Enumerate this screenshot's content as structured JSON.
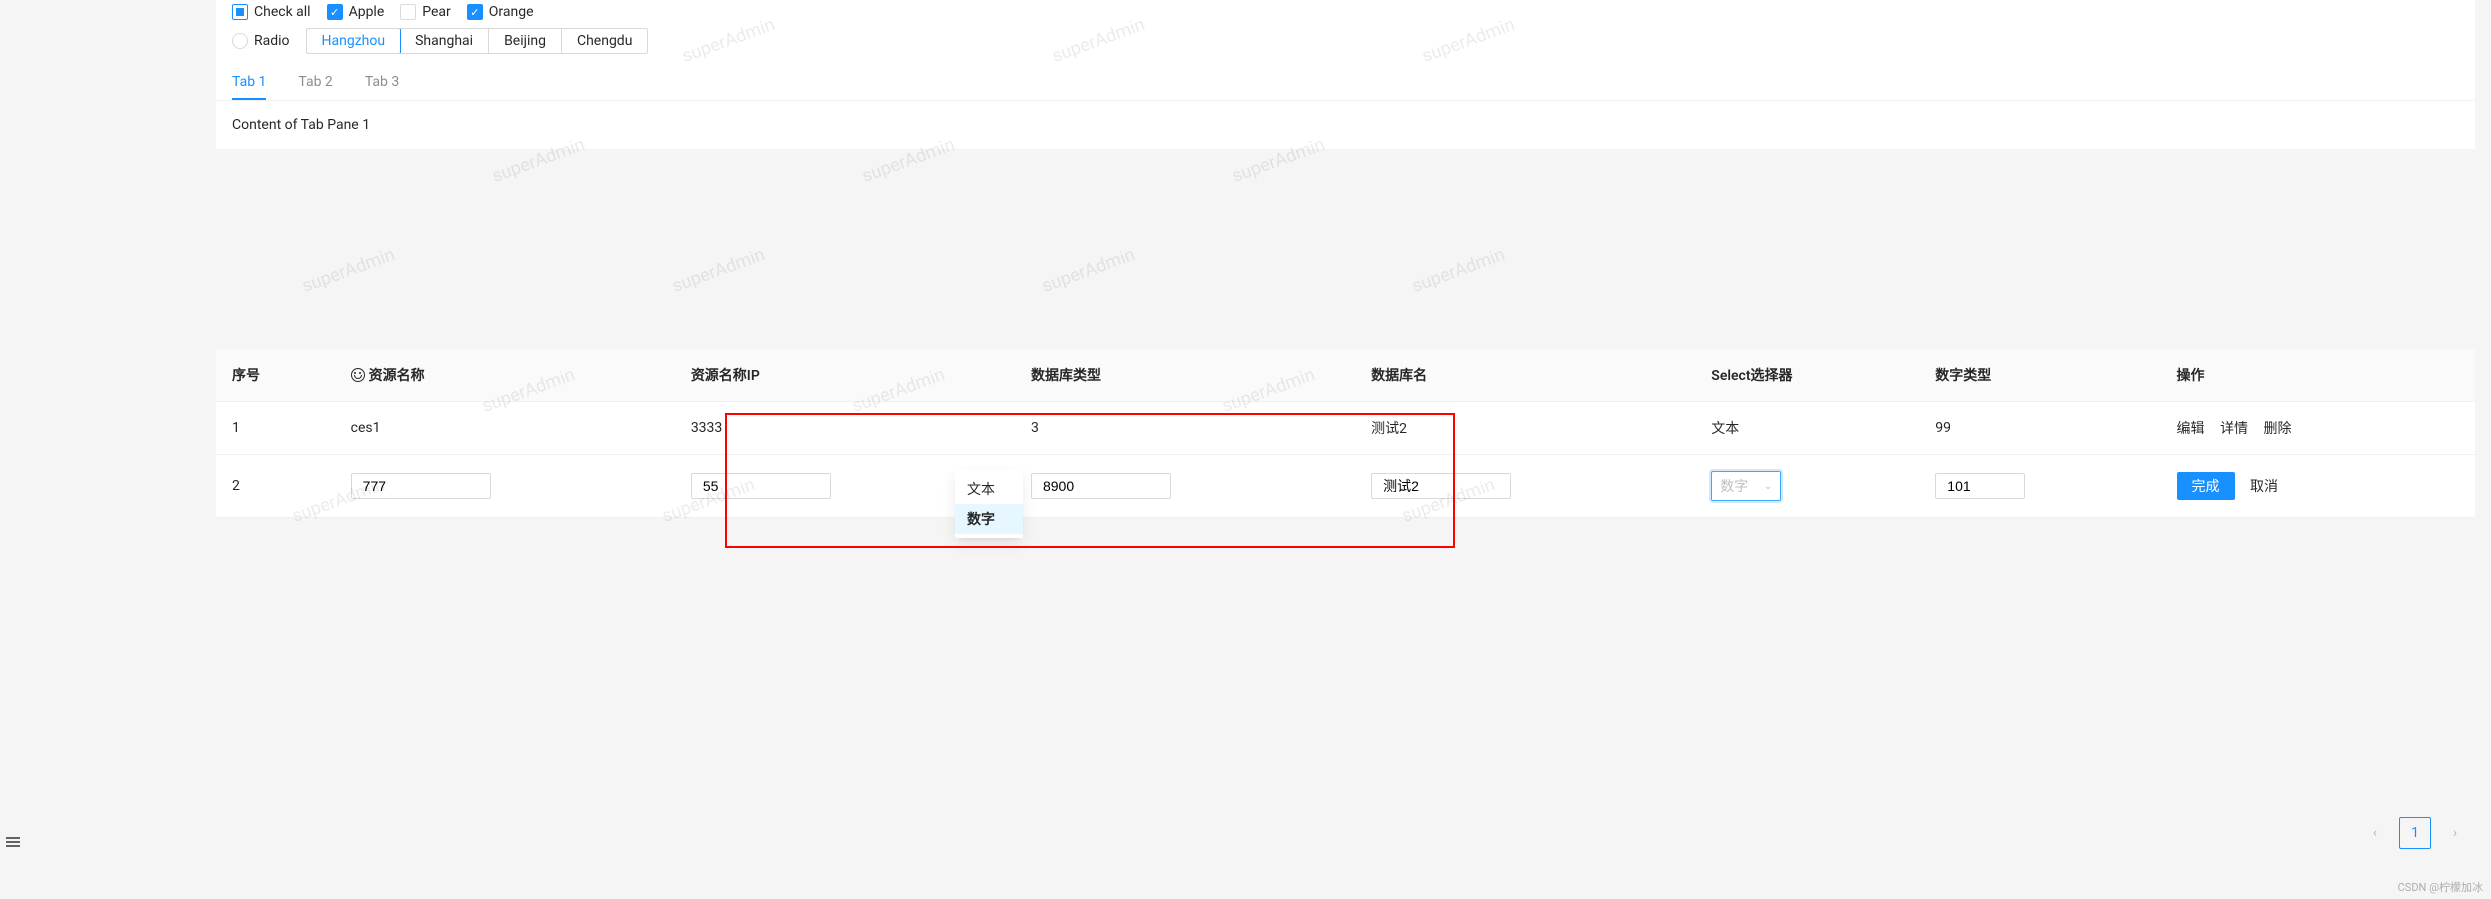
{
  "checks": {
    "all": "Check all",
    "items": [
      "Apple",
      "Pear",
      "Orange"
    ]
  },
  "radio": {
    "label": "Radio",
    "options": [
      "Hangzhou",
      "Shanghai",
      "Beijing",
      "Chengdu"
    ]
  },
  "tabs": [
    "Tab 1",
    "Tab 2",
    "Tab 3"
  ],
  "tabContent": "Content of Tab Pane 1",
  "table": {
    "headers": [
      "序号",
      "资源名称",
      "资源名称IP",
      "数据库类型",
      "数据库名",
      "Select选择器",
      "数字类型",
      "操作"
    ],
    "row1": {
      "idx": "1",
      "name": "ces1",
      "ip": "3333",
      "dbtype": "3",
      "dbname": "测试2",
      "sel": "文本",
      "num": "99"
    },
    "row2": {
      "idx": "2",
      "name": "777",
      "ip": "55",
      "dbtype": "8900",
      "dbname": "测试2",
      "sel": "数字",
      "num": "101"
    },
    "actions": {
      "edit": "编辑",
      "detail": "详情",
      "delete": "删除",
      "done": "完成",
      "cancel": "取消"
    },
    "selectOptions": [
      "文本",
      "数字"
    ]
  },
  "pagination": {
    "current": "1"
  },
  "watermark": "superAdmin",
  "footer": "CSDN @柠檬加冰"
}
